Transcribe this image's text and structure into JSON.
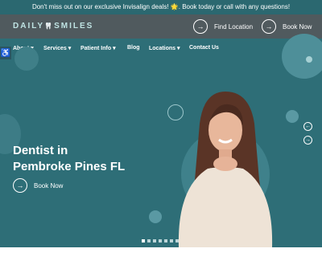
{
  "announcement": "Don't miss out on our exclusive Invisalign deals! 🌟. Book today or call with any questions!",
  "logo": {
    "left": "DAILY",
    "right": "SMILES"
  },
  "header": {
    "find_location": "Find Location",
    "book_now": "Book Now"
  },
  "nav": {
    "items": [
      "About",
      "Services",
      "Patient Info",
      "Blog",
      "Locations",
      "Contact Us"
    ]
  },
  "hero": {
    "title_line1": "Dentist in",
    "title_line2": "Pembroke Pines FL",
    "book_now": "Book Now"
  },
  "colors": {
    "teal": "#2e6e77",
    "header": "#505a5e",
    "bubble": "#4e8f99"
  },
  "slider": {
    "count": 7,
    "active": 1
  }
}
